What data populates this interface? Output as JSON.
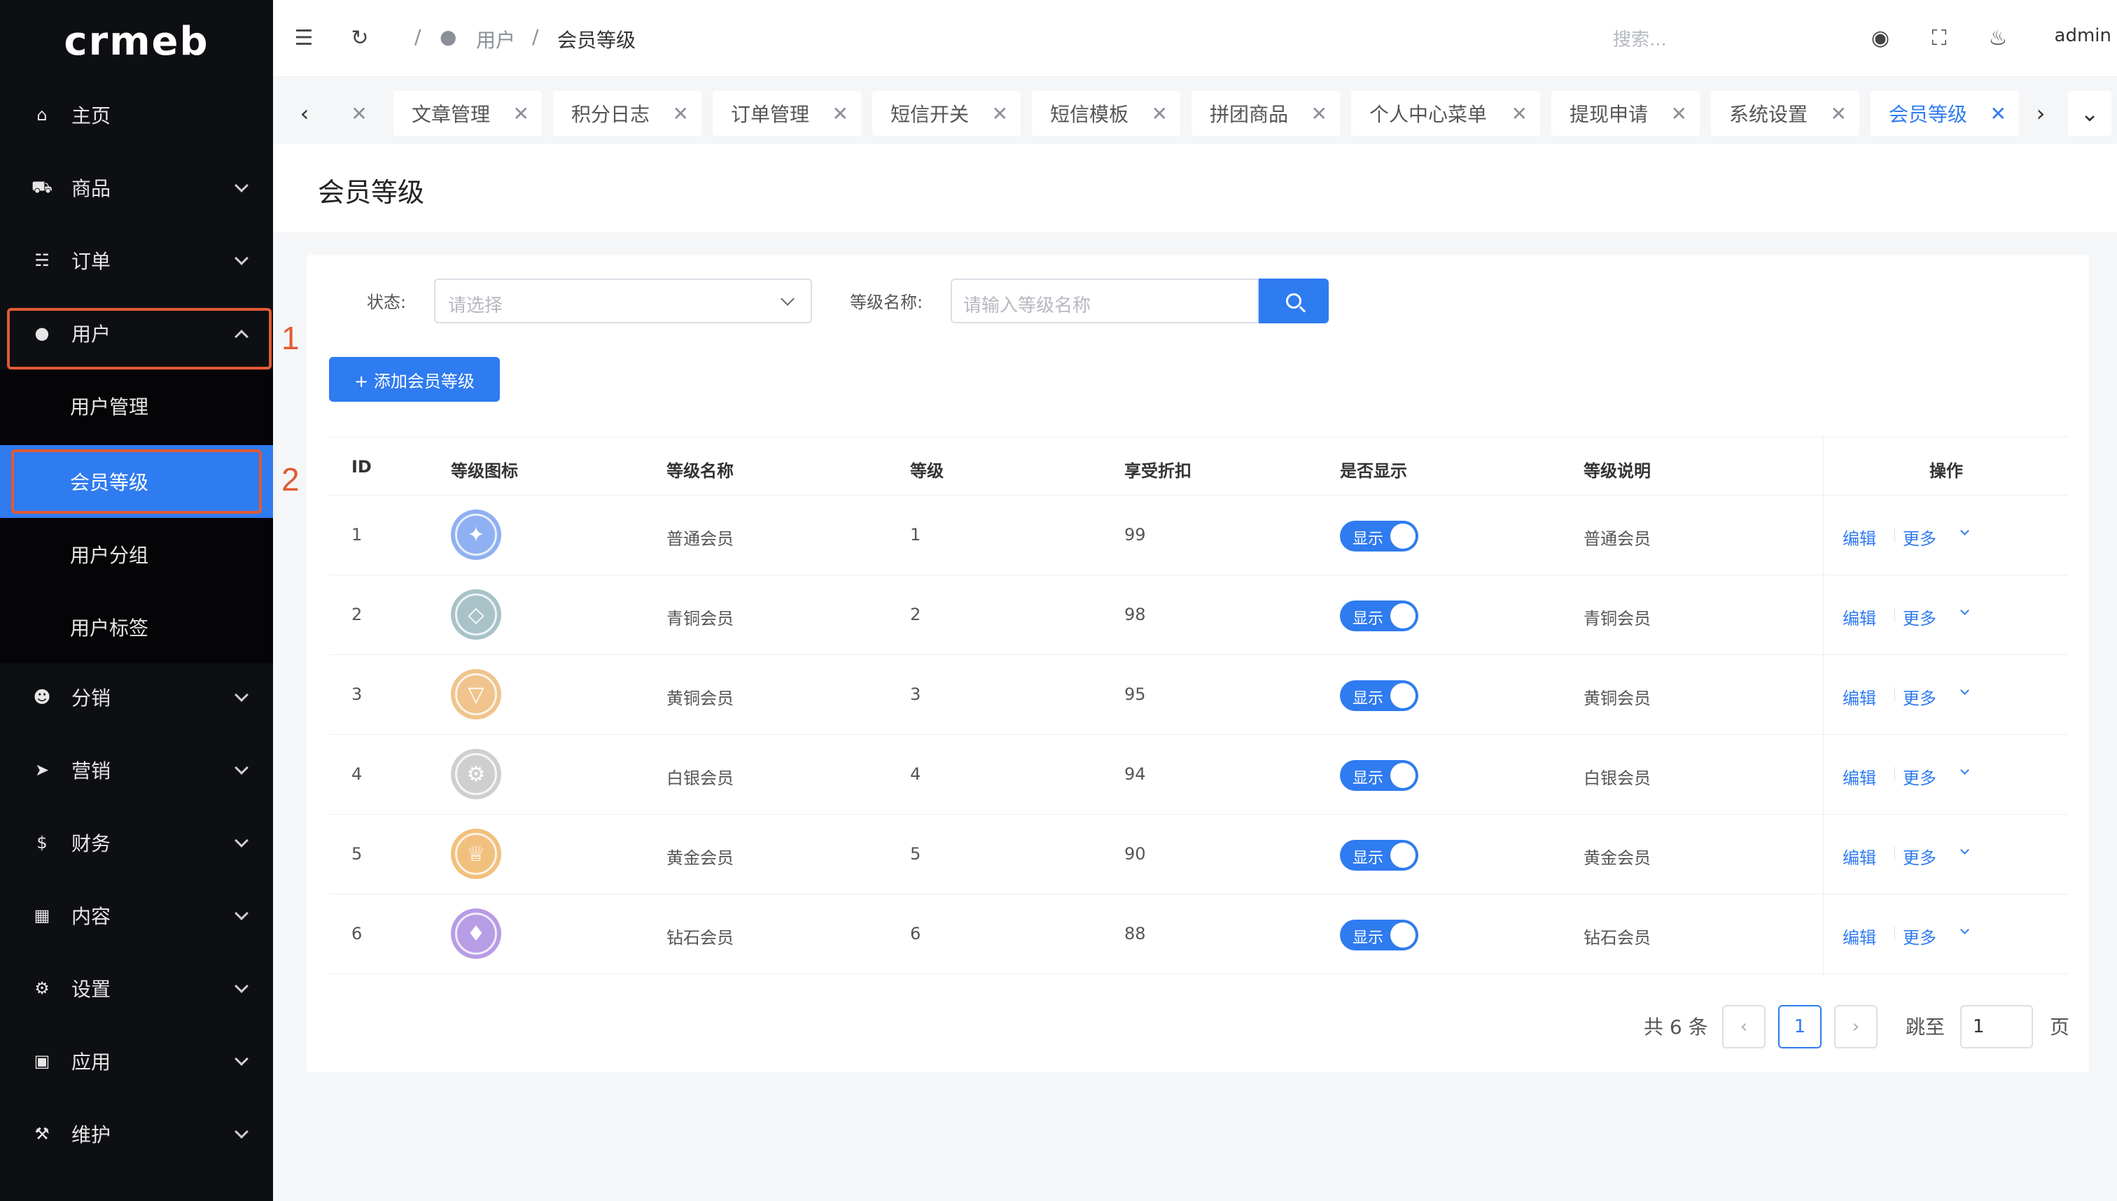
{
  "app": {
    "logo_text": "crmeb"
  },
  "sidebar": {
    "items": [
      {
        "label": "主页",
        "icon": "home-icon"
      },
      {
        "label": "商品",
        "icon": "basket-icon"
      },
      {
        "label": "订单",
        "icon": "cart-icon"
      },
      {
        "label": "用户",
        "icon": "user-icon"
      },
      {
        "label": "分销",
        "icon": "group-icon"
      },
      {
        "label": "营销",
        "icon": "send-icon"
      },
      {
        "label": "财务",
        "icon": "dollar-icon"
      },
      {
        "label": "内容",
        "icon": "book-icon"
      },
      {
        "label": "设置",
        "icon": "gear-icon"
      },
      {
        "label": "应用",
        "icon": "cube-icon"
      },
      {
        "label": "维护",
        "icon": "hammer-icon"
      }
    ],
    "user_submenu": [
      "用户管理",
      "会员等级",
      "用户分组",
      "用户标签"
    ],
    "annotations": [
      "1",
      "2"
    ]
  },
  "header": {
    "breadcrumb": [
      "用户",
      "会员等级"
    ],
    "search_placeholder": "搜索...",
    "username": "admin"
  },
  "tabs": [
    "文章管理",
    "积分日志",
    "订单管理",
    "短信开关",
    "短信模板",
    "拼团商品",
    "个人中心菜单",
    "提现申请",
    "系统设置",
    "会员等级"
  ],
  "page": {
    "title": "会员等级"
  },
  "filters": {
    "status_label": "状态:",
    "status_placeholder": "请选择",
    "name_label": "等级名称:",
    "name_placeholder": "请输入等级名称"
  },
  "add_button": "+ 添加会员等级",
  "table": {
    "columns": [
      "ID",
      "等级图标",
      "等级名称",
      "等级",
      "享受折扣",
      "是否显示",
      "等级说明",
      "操作"
    ],
    "rows": [
      {
        "id": "1",
        "name": "普通会员",
        "grade": "1",
        "discount": "99",
        "show": "显示",
        "desc": "普通会员",
        "icon_color": "#8fb0f2",
        "icon": "star"
      },
      {
        "id": "2",
        "name": "青铜会员",
        "grade": "2",
        "discount": "98",
        "show": "显示",
        "desc": "青铜会员",
        "icon_color": "#a8c2c8",
        "icon": "diamond"
      },
      {
        "id": "3",
        "name": "黄铜会员",
        "grade": "3",
        "discount": "95",
        "show": "显示",
        "desc": "黄铜会员",
        "icon_color": "#f0c48c",
        "icon": "triangle"
      },
      {
        "id": "4",
        "name": "白银会员",
        "grade": "4",
        "discount": "94",
        "show": "显示",
        "desc": "白银会员",
        "icon_color": "#cfcfcf",
        "icon": "gear"
      },
      {
        "id": "5",
        "name": "黄金会员",
        "grade": "5",
        "discount": "90",
        "show": "显示",
        "desc": "黄金会员",
        "icon_color": "#f2c07e",
        "icon": "crown"
      },
      {
        "id": "6",
        "name": "钻石会员",
        "grade": "6",
        "discount": "88",
        "show": "显示",
        "desc": "钻石会员",
        "icon_color": "#b79ce6",
        "icon": "gem"
      }
    ],
    "op_edit": "编辑",
    "op_more": "更多"
  },
  "pagination": {
    "total": "共 6 条",
    "current": "1",
    "jump_label": "跳至",
    "jump_value": "1",
    "page_suffix": "页"
  },
  "colors": {
    "primary": "#2f7bf0",
    "sidebar_bg": "#0e0f13",
    "highlight": "#e25a33"
  }
}
